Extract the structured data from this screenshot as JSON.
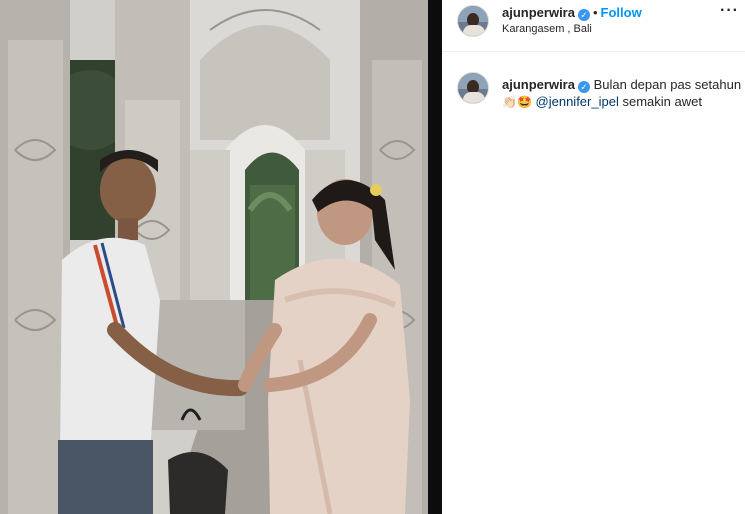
{
  "post": {
    "username": "ajunperwira",
    "verified_mark": "✓",
    "separator": "•",
    "follow_label": "Follow",
    "location": "Karangasem , Bali",
    "more_label": "···"
  },
  "caption": {
    "username": "ajunperwira",
    "text_before": "Bulan depan pas setahun",
    "emoji_1": "👏🏻",
    "emoji_2": "🤩",
    "mention": "@jennifer_ipel",
    "text_after": "semakin awet"
  },
  "icons": {
    "verified": "verified-badge-icon",
    "more": "more-options-icon"
  },
  "colors": {
    "follow": "#0095f6",
    "verified": "#3897f0",
    "mention": "#00376b"
  }
}
